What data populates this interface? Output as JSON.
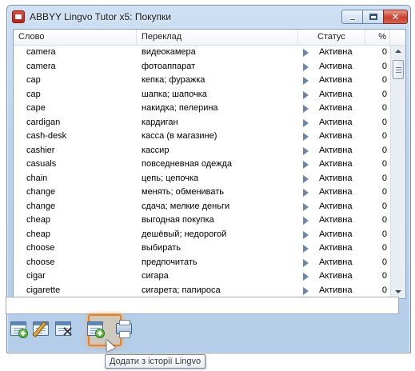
{
  "window": {
    "title": "ABBYY Lingvo Tutor x5: Покупки",
    "icon": "lingvo-tutor-icon"
  },
  "table": {
    "headers": {
      "word": "Слово",
      "translation": "Переклад",
      "status": "Статус",
      "percent": "%"
    },
    "rows": [
      {
        "word": "camera",
        "translation": "видеокамера",
        "status": "Активна",
        "percent": "0"
      },
      {
        "word": "camera",
        "translation": "фотоаппарат",
        "status": "Активна",
        "percent": "0"
      },
      {
        "word": "cap",
        "translation": "кепка; фуражка",
        "status": "Активна",
        "percent": "0"
      },
      {
        "word": "cap",
        "translation": "шапка; шапочка",
        "status": "Активна",
        "percent": "0"
      },
      {
        "word": "cape",
        "translation": "накидка; пелерина",
        "status": "Активна",
        "percent": "0"
      },
      {
        "word": "cardigan",
        "translation": "кардиган",
        "status": "Активна",
        "percent": "0"
      },
      {
        "word": "cash-desk",
        "translation": "касса (в магазине)",
        "status": "Активна",
        "percent": "0"
      },
      {
        "word": "cashier",
        "translation": "кассир",
        "status": "Активна",
        "percent": "0"
      },
      {
        "word": "casuals",
        "translation": "повседневная одежда",
        "status": "Активна",
        "percent": "0"
      },
      {
        "word": "chain",
        "translation": "цепь; цепочка",
        "status": "Активна",
        "percent": "0"
      },
      {
        "word": "change",
        "translation": "менять; обменивать",
        "status": "Активна",
        "percent": "0"
      },
      {
        "word": "change",
        "translation": "сдача; мелкие деньги",
        "status": "Активна",
        "percent": "0"
      },
      {
        "word": "cheap",
        "translation": "выгодная покупка",
        "status": "Активна",
        "percent": "0"
      },
      {
        "word": "cheap",
        "translation": "дешёвый; недорогой",
        "status": "Активна",
        "percent": "0"
      },
      {
        "word": "choose",
        "translation": "выбирать",
        "status": "Активна",
        "percent": "0"
      },
      {
        "word": "choose",
        "translation": "предпочитать",
        "status": "Активна",
        "percent": "0"
      },
      {
        "word": "cigar",
        "translation": "сигара",
        "status": "Активна",
        "percent": "0"
      },
      {
        "word": "cigarette",
        "translation": "сигарета; папироса",
        "status": "Активна",
        "percent": "0"
      }
    ]
  },
  "input": {
    "value": ""
  },
  "toolbar": {
    "buttons": [
      {
        "name": "add-card-button",
        "icon": "add-card-icon"
      },
      {
        "name": "edit-card-button",
        "icon": "edit-card-icon"
      },
      {
        "name": "delete-card-button",
        "icon": "delete-card-icon"
      },
      {
        "name": "add-from-history-button",
        "icon": "add-from-history-icon"
      },
      {
        "name": "print-button",
        "icon": "printer-icon"
      }
    ]
  },
  "tooltip": {
    "text": "Додати з історії Lingvo"
  },
  "colors": {
    "highlight": "#f07f18",
    "status_arrow": "#6a86ad",
    "close_button": "#c9412e"
  }
}
